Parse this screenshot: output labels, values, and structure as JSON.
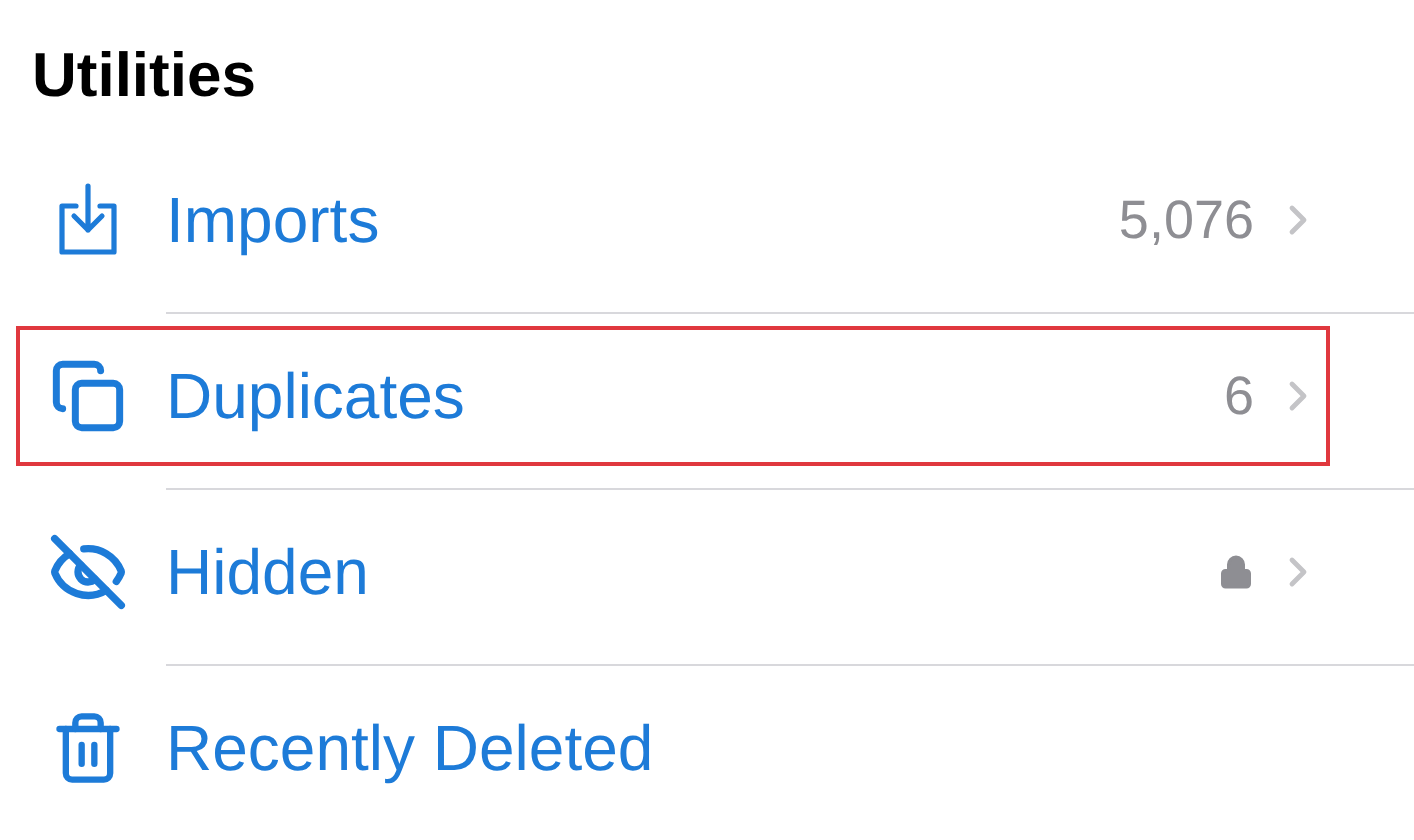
{
  "section_title": "Utilities",
  "items": [
    {
      "label": "Imports",
      "count": "5,076",
      "locked": false,
      "chevron": true,
      "highlighted": false
    },
    {
      "label": "Duplicates",
      "count": "6",
      "locked": false,
      "chevron": true,
      "highlighted": true
    },
    {
      "label": "Hidden",
      "locked": true,
      "chevron": true,
      "highlighted": false
    },
    {
      "label": "Recently Deleted",
      "locked": false,
      "chevron": false,
      "highlighted": false
    }
  ]
}
